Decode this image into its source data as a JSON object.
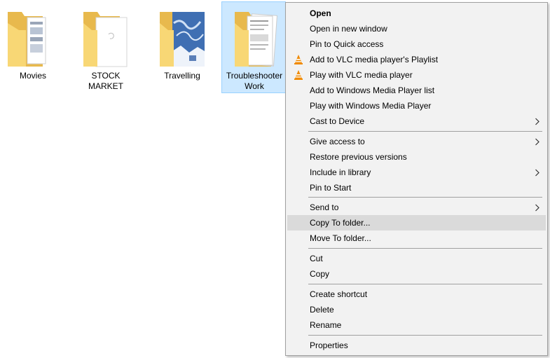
{
  "folders": [
    {
      "label": "Movies"
    },
    {
      "label": "STOCK MARKET"
    },
    {
      "label": "Travelling"
    },
    {
      "label": "Troubleshooter\nWork"
    }
  ],
  "icons": {
    "folder": "folder-icon",
    "vlc": "vlc-cone-icon",
    "submenu": "chevron-right-icon"
  },
  "colors": {
    "folder_back": "#e8b94d",
    "folder_front": "#f8d775",
    "selection_bg": "#cce8ff",
    "selection_border": "#99d1ff",
    "menu_bg": "#f2f2f2",
    "menu_hover": "#dadada",
    "separator": "#a0a0a0",
    "vlc_orange": "#f08a00"
  },
  "menu": {
    "open": "Open",
    "open_new_window": "Open in new window",
    "pin_quick_access": "Pin to Quick access",
    "add_vlc_playlist": "Add to VLC media player's Playlist",
    "play_vlc": "Play with VLC media player",
    "add_wmp_list": "Add to Windows Media Player list",
    "play_wmp": "Play with Windows Media Player",
    "cast_to_device": "Cast to Device",
    "give_access": "Give access to",
    "restore_versions": "Restore previous versions",
    "include_library": "Include in library",
    "pin_start": "Pin to Start",
    "send_to": "Send to",
    "copy_to_folder": "Copy To folder...",
    "move_to_folder": "Move To folder...",
    "cut": "Cut",
    "copy": "Copy",
    "create_shortcut": "Create shortcut",
    "delete": "Delete",
    "rename": "Rename",
    "properties": "Properties"
  }
}
